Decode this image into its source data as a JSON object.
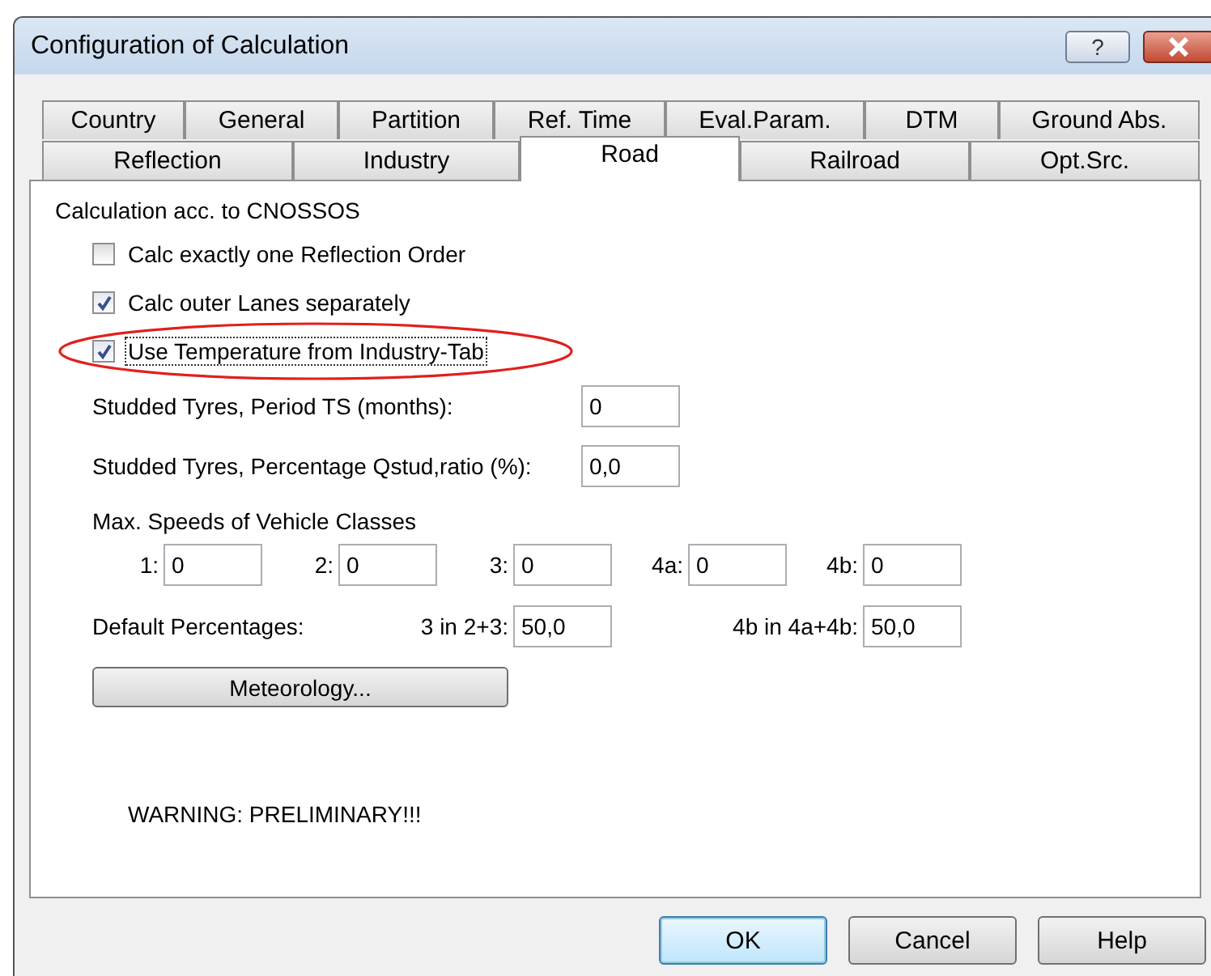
{
  "window": {
    "title": "Configuration of Calculation",
    "help_button": "?"
  },
  "tab_rows": [
    [
      {
        "label": "Country",
        "selected": false
      },
      {
        "label": "General",
        "selected": false
      },
      {
        "label": "Partition",
        "selected": false
      },
      {
        "label": "Ref. Time",
        "selected": false
      },
      {
        "label": "Eval.Param.",
        "selected": false
      },
      {
        "label": "DTM",
        "selected": false
      },
      {
        "label": "Ground Abs.",
        "selected": false
      }
    ],
    [
      {
        "label": "Reflection",
        "selected": false
      },
      {
        "label": "Industry",
        "selected": false
      },
      {
        "label": "Road",
        "selected": true
      },
      {
        "label": "Railroad",
        "selected": false
      },
      {
        "label": "Opt.Src.",
        "selected": false
      }
    ]
  ],
  "panel": {
    "heading": "Calculation acc. to CNOSSOS",
    "checkboxes": [
      {
        "label": "Calc exactly one Reflection Order",
        "checked": false,
        "focused": false,
        "circled": false
      },
      {
        "label": "Calc outer Lanes separately",
        "checked": true,
        "focused": false,
        "circled": false
      },
      {
        "label": "Use Temperature from Industry-Tab",
        "checked": true,
        "focused": true,
        "circled": true
      }
    ],
    "studded_fields": [
      {
        "label": "Studded Tyres, Period TS  (months):",
        "value": "0"
      },
      {
        "label": "Studded Tyres, Percentage Qstud,ratio (%):",
        "value": "0,0"
      }
    ],
    "speeds_heading": "Max. Speeds of Vehicle Classes",
    "vehicle_classes": [
      {
        "label": "1:",
        "value": "0"
      },
      {
        "label": "2:",
        "value": "0"
      },
      {
        "label": "3:",
        "value": "0"
      },
      {
        "label": "4a:",
        "value": "0"
      },
      {
        "label": "4b:",
        "value": "0"
      }
    ],
    "default_percentages": {
      "label": "Default Percentages:",
      "items": [
        {
          "label": "3 in 2+3:",
          "value": "50,0"
        },
        {
          "label": "4b in 4a+4b:",
          "value": "50,0"
        }
      ]
    },
    "meteorology_button": "Meteorology...",
    "warning": "WARNING: PRELIMINARY!!!"
  },
  "buttons": [
    {
      "label": "OK",
      "default": true
    },
    {
      "label": "Cancel",
      "default": false
    },
    {
      "label": "Help",
      "default": false
    }
  ]
}
